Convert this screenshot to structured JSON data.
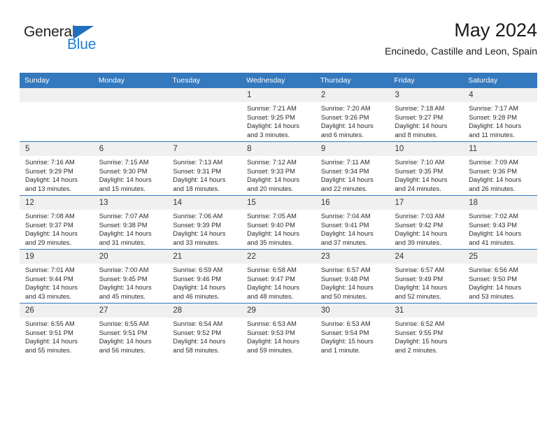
{
  "brand": {
    "name_part1": "General",
    "name_part2": "Blue",
    "triangle_color": "#1f6fc0",
    "blue_color": "#1f7fd4"
  },
  "header": {
    "title": "May 2024",
    "subtitle": "Encinedo, Castille and Leon, Spain"
  },
  "theme": {
    "header_bar_color": "#3478bd",
    "daynum_band_color": "#f0f0f0",
    "text_color": "#2b2b2b"
  },
  "weekday_headers": [
    "Sunday",
    "Monday",
    "Tuesday",
    "Wednesday",
    "Thursday",
    "Friday",
    "Saturday"
  ],
  "weeks": [
    [
      {
        "day": "",
        "blank": true
      },
      {
        "day": "",
        "blank": true
      },
      {
        "day": "",
        "blank": true
      },
      {
        "day": "1",
        "sunrise": "Sunrise: 7:21 AM",
        "sunset": "Sunset: 9:25 PM",
        "daylight": "Daylight: 14 hours and 3 minutes."
      },
      {
        "day": "2",
        "sunrise": "Sunrise: 7:20 AM",
        "sunset": "Sunset: 9:26 PM",
        "daylight": "Daylight: 14 hours and 6 minutes."
      },
      {
        "day": "3",
        "sunrise": "Sunrise: 7:18 AM",
        "sunset": "Sunset: 9:27 PM",
        "daylight": "Daylight: 14 hours and 8 minutes."
      },
      {
        "day": "4",
        "sunrise": "Sunrise: 7:17 AM",
        "sunset": "Sunset: 9:28 PM",
        "daylight": "Daylight: 14 hours and 11 minutes."
      }
    ],
    [
      {
        "day": "5",
        "sunrise": "Sunrise: 7:16 AM",
        "sunset": "Sunset: 9:29 PM",
        "daylight": "Daylight: 14 hours and 13 minutes."
      },
      {
        "day": "6",
        "sunrise": "Sunrise: 7:15 AM",
        "sunset": "Sunset: 9:30 PM",
        "daylight": "Daylight: 14 hours and 15 minutes."
      },
      {
        "day": "7",
        "sunrise": "Sunrise: 7:13 AM",
        "sunset": "Sunset: 9:31 PM",
        "daylight": "Daylight: 14 hours and 18 minutes."
      },
      {
        "day": "8",
        "sunrise": "Sunrise: 7:12 AM",
        "sunset": "Sunset: 9:33 PM",
        "daylight": "Daylight: 14 hours and 20 minutes."
      },
      {
        "day": "9",
        "sunrise": "Sunrise: 7:11 AM",
        "sunset": "Sunset: 9:34 PM",
        "daylight": "Daylight: 14 hours and 22 minutes."
      },
      {
        "day": "10",
        "sunrise": "Sunrise: 7:10 AM",
        "sunset": "Sunset: 9:35 PM",
        "daylight": "Daylight: 14 hours and 24 minutes."
      },
      {
        "day": "11",
        "sunrise": "Sunrise: 7:09 AM",
        "sunset": "Sunset: 9:36 PM",
        "daylight": "Daylight: 14 hours and 26 minutes."
      }
    ],
    [
      {
        "day": "12",
        "sunrise": "Sunrise: 7:08 AM",
        "sunset": "Sunset: 9:37 PM",
        "daylight": "Daylight: 14 hours and 29 minutes."
      },
      {
        "day": "13",
        "sunrise": "Sunrise: 7:07 AM",
        "sunset": "Sunset: 9:38 PM",
        "daylight": "Daylight: 14 hours and 31 minutes."
      },
      {
        "day": "14",
        "sunrise": "Sunrise: 7:06 AM",
        "sunset": "Sunset: 9:39 PM",
        "daylight": "Daylight: 14 hours and 33 minutes."
      },
      {
        "day": "15",
        "sunrise": "Sunrise: 7:05 AM",
        "sunset": "Sunset: 9:40 PM",
        "daylight": "Daylight: 14 hours and 35 minutes."
      },
      {
        "day": "16",
        "sunrise": "Sunrise: 7:04 AM",
        "sunset": "Sunset: 9:41 PM",
        "daylight": "Daylight: 14 hours and 37 minutes."
      },
      {
        "day": "17",
        "sunrise": "Sunrise: 7:03 AM",
        "sunset": "Sunset: 9:42 PM",
        "daylight": "Daylight: 14 hours and 39 minutes."
      },
      {
        "day": "18",
        "sunrise": "Sunrise: 7:02 AM",
        "sunset": "Sunset: 9:43 PM",
        "daylight": "Daylight: 14 hours and 41 minutes."
      }
    ],
    [
      {
        "day": "19",
        "sunrise": "Sunrise: 7:01 AM",
        "sunset": "Sunset: 9:44 PM",
        "daylight": "Daylight: 14 hours and 43 minutes."
      },
      {
        "day": "20",
        "sunrise": "Sunrise: 7:00 AM",
        "sunset": "Sunset: 9:45 PM",
        "daylight": "Daylight: 14 hours and 45 minutes."
      },
      {
        "day": "21",
        "sunrise": "Sunrise: 6:59 AM",
        "sunset": "Sunset: 9:46 PM",
        "daylight": "Daylight: 14 hours and 46 minutes."
      },
      {
        "day": "22",
        "sunrise": "Sunrise: 6:58 AM",
        "sunset": "Sunset: 9:47 PM",
        "daylight": "Daylight: 14 hours and 48 minutes."
      },
      {
        "day": "23",
        "sunrise": "Sunrise: 6:57 AM",
        "sunset": "Sunset: 9:48 PM",
        "daylight": "Daylight: 14 hours and 50 minutes."
      },
      {
        "day": "24",
        "sunrise": "Sunrise: 6:57 AM",
        "sunset": "Sunset: 9:49 PM",
        "daylight": "Daylight: 14 hours and 52 minutes."
      },
      {
        "day": "25",
        "sunrise": "Sunrise: 6:56 AM",
        "sunset": "Sunset: 9:50 PM",
        "daylight": "Daylight: 14 hours and 53 minutes."
      }
    ],
    [
      {
        "day": "26",
        "sunrise": "Sunrise: 6:55 AM",
        "sunset": "Sunset: 9:51 PM",
        "daylight": "Daylight: 14 hours and 55 minutes."
      },
      {
        "day": "27",
        "sunrise": "Sunrise: 6:55 AM",
        "sunset": "Sunset: 9:51 PM",
        "daylight": "Daylight: 14 hours and 56 minutes."
      },
      {
        "day": "28",
        "sunrise": "Sunrise: 6:54 AM",
        "sunset": "Sunset: 9:52 PM",
        "daylight": "Daylight: 14 hours and 58 minutes."
      },
      {
        "day": "29",
        "sunrise": "Sunrise: 6:53 AM",
        "sunset": "Sunset: 9:53 PM",
        "daylight": "Daylight: 14 hours and 59 minutes."
      },
      {
        "day": "30",
        "sunrise": "Sunrise: 6:53 AM",
        "sunset": "Sunset: 9:54 PM",
        "daylight": "Daylight: 15 hours and 1 minute."
      },
      {
        "day": "31",
        "sunrise": "Sunrise: 6:52 AM",
        "sunset": "Sunset: 9:55 PM",
        "daylight": "Daylight: 15 hours and 2 minutes."
      },
      {
        "day": "",
        "blank": true
      }
    ]
  ]
}
